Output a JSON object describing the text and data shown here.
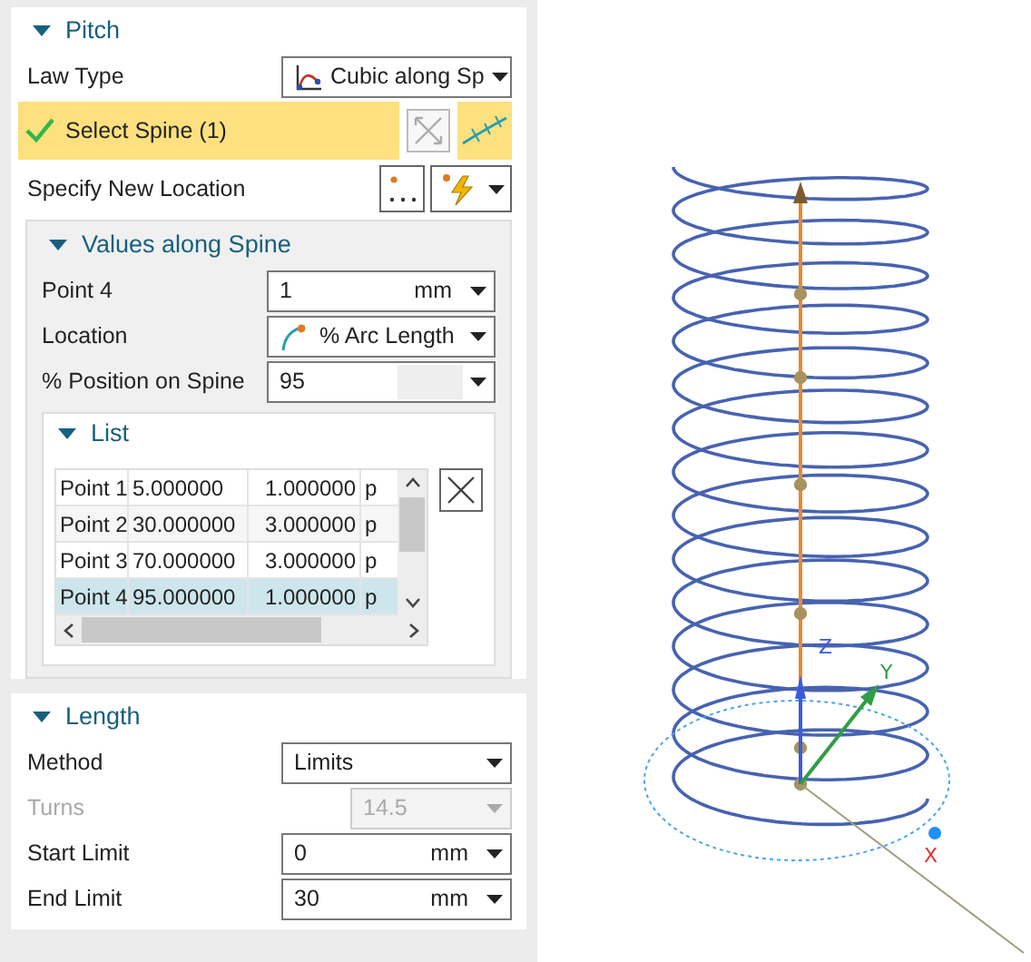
{
  "pitch": {
    "title": "Pitch",
    "expanded": true,
    "law_type": {
      "label": "Law Type",
      "value": "Cubic along Sp"
    },
    "select_spine": {
      "label": "Select Spine (1)",
      "done": true
    },
    "new_location": {
      "label": "Specify New Location"
    },
    "values": {
      "title": "Values along Spine",
      "expanded": true,
      "fields": [
        {
          "label": "Point 4",
          "value": "1",
          "unit": "mm",
          "kind": "unit"
        },
        {
          "label": "Location",
          "value": "% Arc Length",
          "kind": "location"
        },
        {
          "label": "% Position on Spine",
          "value": "95",
          "kind": "shaded"
        }
      ],
      "list": {
        "title": "List",
        "expanded": true,
        "rows": [
          {
            "cells": [
              "Point 1",
              "5.000000",
              "1.000000",
              "p"
            ],
            "selected": false
          },
          {
            "cells": [
              "Point 2",
              "30.000000",
              "3.000000",
              "p"
            ],
            "selected": false
          },
          {
            "cells": [
              "Point 3",
              "70.000000",
              "3.000000",
              "p"
            ],
            "selected": false
          },
          {
            "cells": [
              "Point 4",
              "95.000000",
              "1.000000",
              "p"
            ],
            "selected": true
          }
        ]
      }
    }
  },
  "length": {
    "title": "Length",
    "expanded": true,
    "fields": [
      {
        "label": "Method",
        "value": "Limits",
        "disabled": false
      },
      {
        "label": "Turns",
        "value": "14.5",
        "disabled": true
      },
      {
        "label": "Start Limit",
        "value": "0",
        "unit": "mm",
        "disabled": false
      },
      {
        "label": "End Limit",
        "value": "30",
        "unit": "mm",
        "disabled": false
      }
    ]
  },
  "viewport": {
    "axes": [
      {
        "label": "Z",
        "color": "#3b5bdb"
      },
      {
        "label": "Y",
        "color": "#2f9e44"
      },
      {
        "label": "X",
        "color": "#e03131"
      }
    ]
  }
}
